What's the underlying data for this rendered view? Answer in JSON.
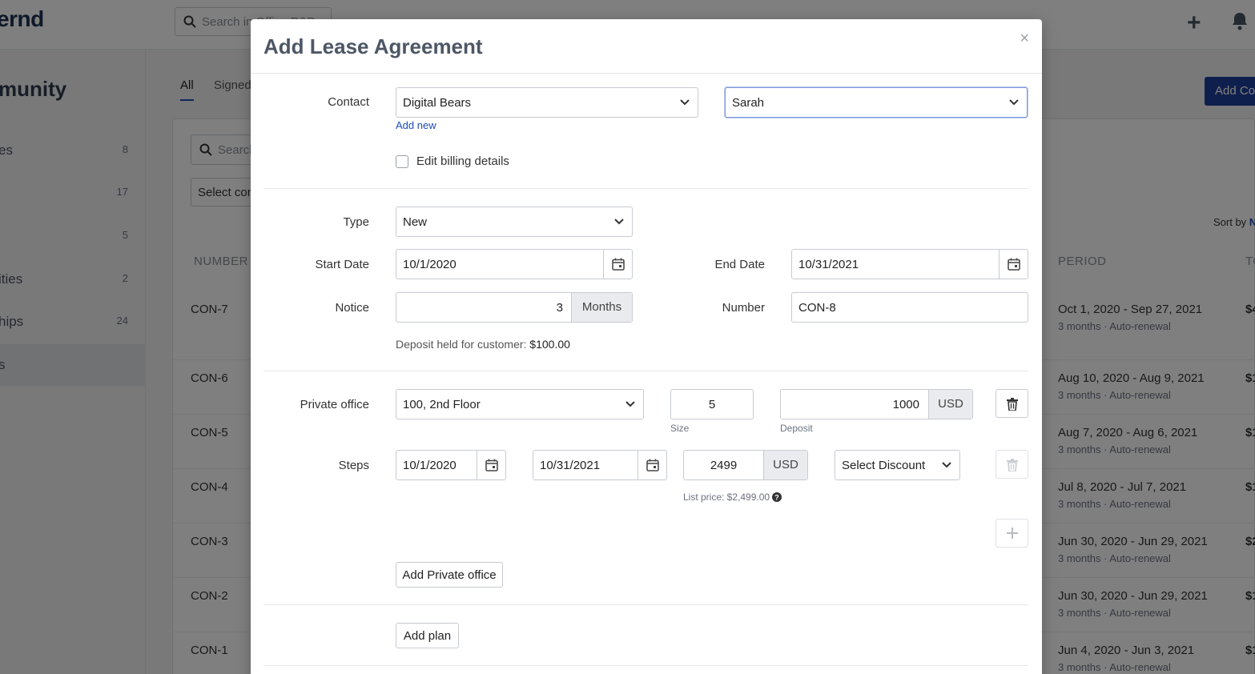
{
  "app": {
    "logo": "ernd",
    "search_placeholder": "Search in Office R&D",
    "sidebar_title": "munity",
    "sidebar_items": [
      {
        "label": "es",
        "count": "8"
      },
      {
        "label": "",
        "count": "17"
      },
      {
        "label": "",
        "count": "5"
      },
      {
        "label": "ities",
        "count": "2"
      },
      {
        "label": "hips",
        "count": "24"
      },
      {
        "label": "s",
        "count": ""
      }
    ],
    "tabs": [
      "All",
      "Signed"
    ],
    "search_placeholder_2": "Search",
    "select_placeholder": "Select com",
    "add_button": "Add Co",
    "sort_by": "Sort by",
    "sort_by_value": "N",
    "columns": {
      "number": "NUMBER",
      "period": "PERIOD",
      "total": "TO"
    },
    "rows": [
      {
        "number": "CON-7",
        "period": "Oct 1, 2020 - Sep 27, 2021",
        "sub": "3 months  ·  Auto-renewal",
        "amount": "$4"
      },
      {
        "number": "CON-6",
        "period": "Aug 10, 2020 - Aug 9, 2021",
        "sub": "3 months  ·  Auto-renewal",
        "amount": "$1"
      },
      {
        "number": "CON-5",
        "period": "Aug 7, 2020 - Aug 6, 2021",
        "sub": "3 months  ·  Auto-renewal",
        "amount": "$1"
      },
      {
        "number": "CON-4",
        "period": "Jul 8, 2020 - Jul 7, 2021",
        "sub": "3 months  ·  Auto-renewal",
        "amount": "$1"
      },
      {
        "number": "CON-3",
        "period": "Jun 30, 2020 - Jun 29, 2021",
        "sub": "3 months  ·  Auto-renewal",
        "amount": "$2"
      },
      {
        "number": "CON-2",
        "period": "Jun 30, 2020 - Jun 29, 2021",
        "sub": "3 months  ·  Auto-renewal",
        "amount": "$1"
      },
      {
        "number": "CON-1",
        "period": "Jun 4, 2020 - Jun 3, 2021",
        "sub": "3 months  ·  Auto-renewal",
        "amount": "$1"
      }
    ]
  },
  "modal": {
    "title": "Add Lease Agreement",
    "close": "×",
    "contact": {
      "label": "Contact",
      "company": "Digital Bears",
      "person": "Sarah",
      "add_new": "Add new",
      "edit_billing": "Edit billing details"
    },
    "type": {
      "label": "Type",
      "value": "New"
    },
    "start_date": {
      "label": "Start Date",
      "value": "10/1/2020"
    },
    "end_date": {
      "label": "End Date",
      "value": "10/31/2021"
    },
    "notice": {
      "label": "Notice",
      "value": "3",
      "unit": "Months"
    },
    "number": {
      "label": "Number",
      "value": "CON-8"
    },
    "deposit_note": {
      "prefix": "Deposit held for customer: ",
      "amount": "$100.00"
    },
    "private_office": {
      "label": "Private office",
      "office": "100, 2nd Floor",
      "size": "5",
      "size_label": "Size",
      "deposit": "1000",
      "deposit_currency": "USD",
      "deposit_label": "Deposit"
    },
    "steps": {
      "label": "Steps",
      "start": "10/1/2020",
      "end": "10/31/2021",
      "price": "2499",
      "currency": "USD",
      "discount": "Select Discount",
      "list_price": "List price: $2,499.00"
    },
    "add_private_office": "Add Private office",
    "add_plan": "Add plan"
  }
}
